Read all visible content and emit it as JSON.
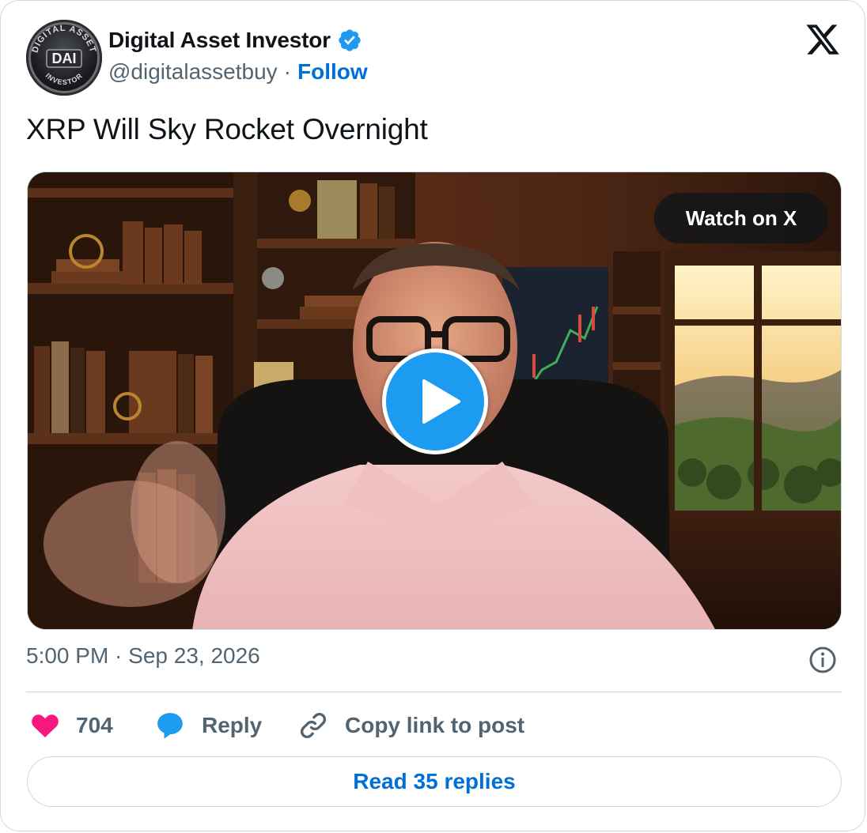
{
  "author": {
    "display_name": "Digital Asset Investor",
    "handle": "@digitalassetbuy",
    "separator": "·",
    "follow_label": "Follow",
    "verified": true,
    "avatar_text": {
      "top": "DIGITAL ASSET",
      "center": "DAI",
      "bottom": "INVESTOR"
    }
  },
  "tweet": {
    "text": "XRP Will Sky Rocket Overnight",
    "timestamp": "5:00 PM · Sep 23, 2026"
  },
  "media": {
    "type": "video",
    "watch_label": "Watch on X"
  },
  "actions": {
    "like_count": "704",
    "reply_label": "Reply",
    "copy_link_label": "Copy link to post"
  },
  "read_replies_label": "Read 35 replies",
  "colors": {
    "accent_blue": "#1d9bf0",
    "link_blue": "#006fd6",
    "like_pink": "#f91880",
    "text_primary": "#0f1419",
    "text_secondary": "#536471",
    "border": "#cfd9de"
  }
}
